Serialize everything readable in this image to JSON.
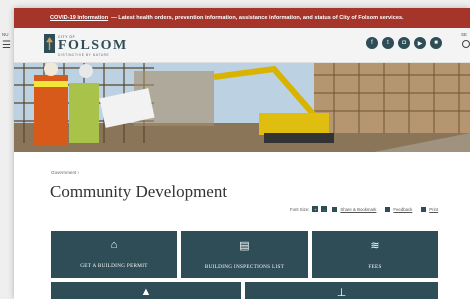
{
  "alert": {
    "link": "COVID-19 Information",
    "text": "— Latest health orders, prevention information, assistance information, and status of City of Folsom services."
  },
  "edge": {
    "menu_label": "NU",
    "search_label": "SE"
  },
  "logo": {
    "small": "CITY OF",
    "main": "FOLSOM",
    "tagline": "DISTINCTIVE BY NATURE"
  },
  "social": [
    {
      "name": "facebook-icon",
      "glyph": "f"
    },
    {
      "name": "twitter-icon",
      "glyph": "t"
    },
    {
      "name": "instagram-icon",
      "glyph": "◘"
    },
    {
      "name": "youtube-icon",
      "glyph": "▶"
    },
    {
      "name": "news-icon",
      "glyph": "■"
    }
  ],
  "breadcrumb": "Government ›",
  "page_title": "Community Development",
  "tools": {
    "font_size": "Font Size:",
    "plus": "+",
    "minus": "-",
    "share": "Share & Bookmark",
    "feedback": "Feedback",
    "print": "Print"
  },
  "tiles": [
    {
      "label": "GET A BUILDING PERMIT",
      "icon": "home-icon",
      "glyph": "⌂"
    },
    {
      "label": "BUILDING INSPECTIONS LIST",
      "icon": "clipboard-icon",
      "glyph": "▤"
    },
    {
      "label": "FEES",
      "icon": "layers-icon",
      "glyph": "≋"
    },
    {
      "label": "",
      "icon": "warning-icon",
      "glyph": "▲"
    },
    {
      "label": "",
      "icon": "pin-icon",
      "glyph": "⊥"
    }
  ],
  "colors": {
    "alert": "#a5342a",
    "brand": "#2e4d57",
    "accent": "#c8a25b"
  }
}
